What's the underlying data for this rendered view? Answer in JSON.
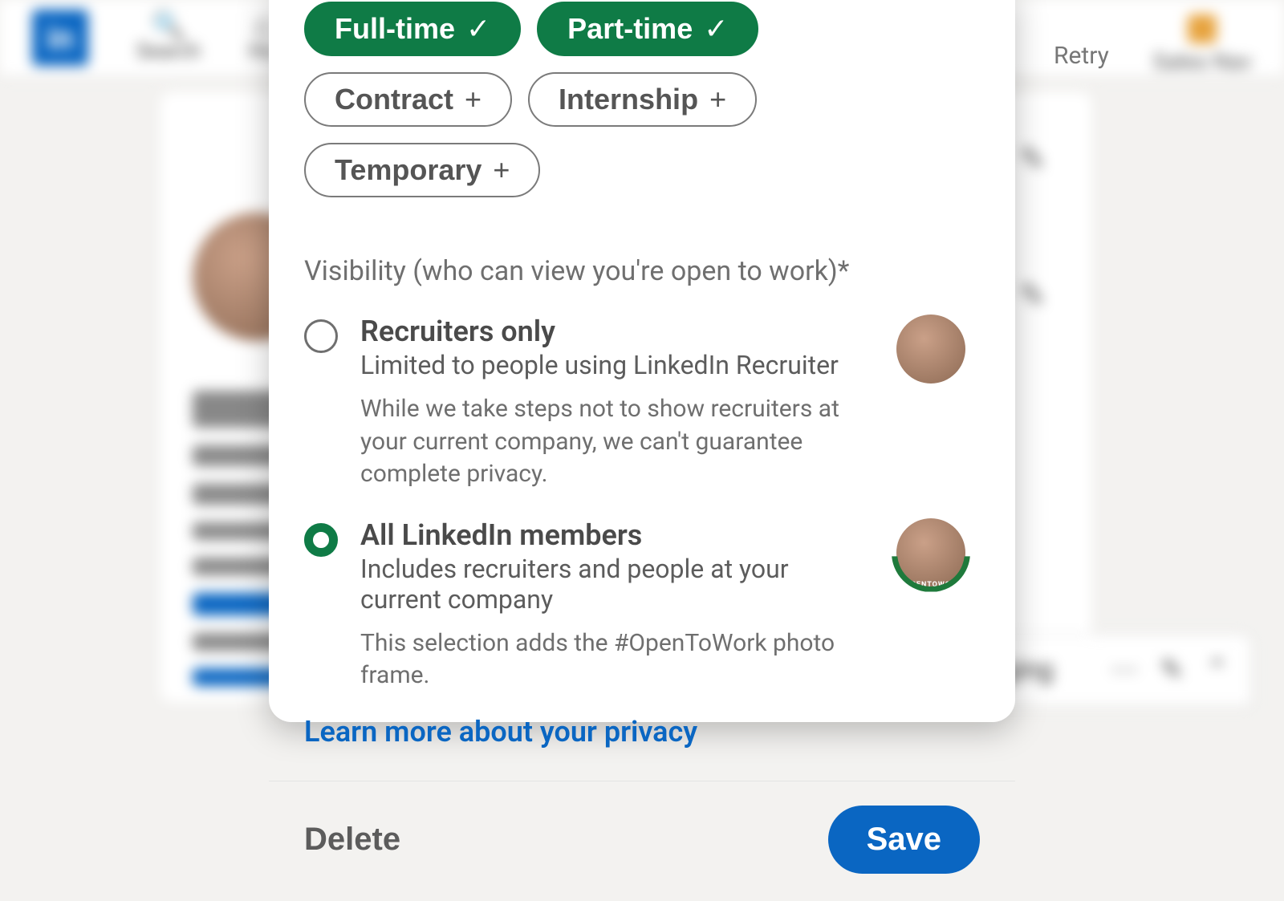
{
  "nav": {
    "logo_text": "in",
    "search_label": "Search",
    "home_label": "Ho",
    "retry_label": "Retry",
    "sales_label": "Sales Nav"
  },
  "messaging": {
    "label": "aging"
  },
  "modal": {
    "chips": [
      {
        "label": "Full-time",
        "selected": true
      },
      {
        "label": "Part-time",
        "selected": true
      },
      {
        "label": "Contract",
        "selected": false
      },
      {
        "label": "Internship",
        "selected": false
      },
      {
        "label": "Temporary",
        "selected": false
      }
    ],
    "visibility_label": "Visibility (who can view you're open to work)*",
    "options": [
      {
        "id": "recruiters",
        "title": "Recruiters only",
        "subtitle": "Limited to people using LinkedIn Recruiter",
        "note": "While we take steps not to show recruiters at your current company, we can't guarantee complete privacy.",
        "selected": false,
        "frame": false
      },
      {
        "id": "all",
        "title": "All LinkedIn members",
        "subtitle": "Includes recruiters and people at your current company",
        "note": "This selection adds the #OpenToWork photo frame.",
        "selected": true,
        "frame": true
      }
    ],
    "privacy_link": "Learn more about your privacy",
    "delete_label": "Delete",
    "save_label": "Save",
    "frame_tag": "#OPENTOWORK"
  },
  "colors": {
    "brand_blue": "#0a66c2",
    "chip_green": "#0f7b46"
  }
}
